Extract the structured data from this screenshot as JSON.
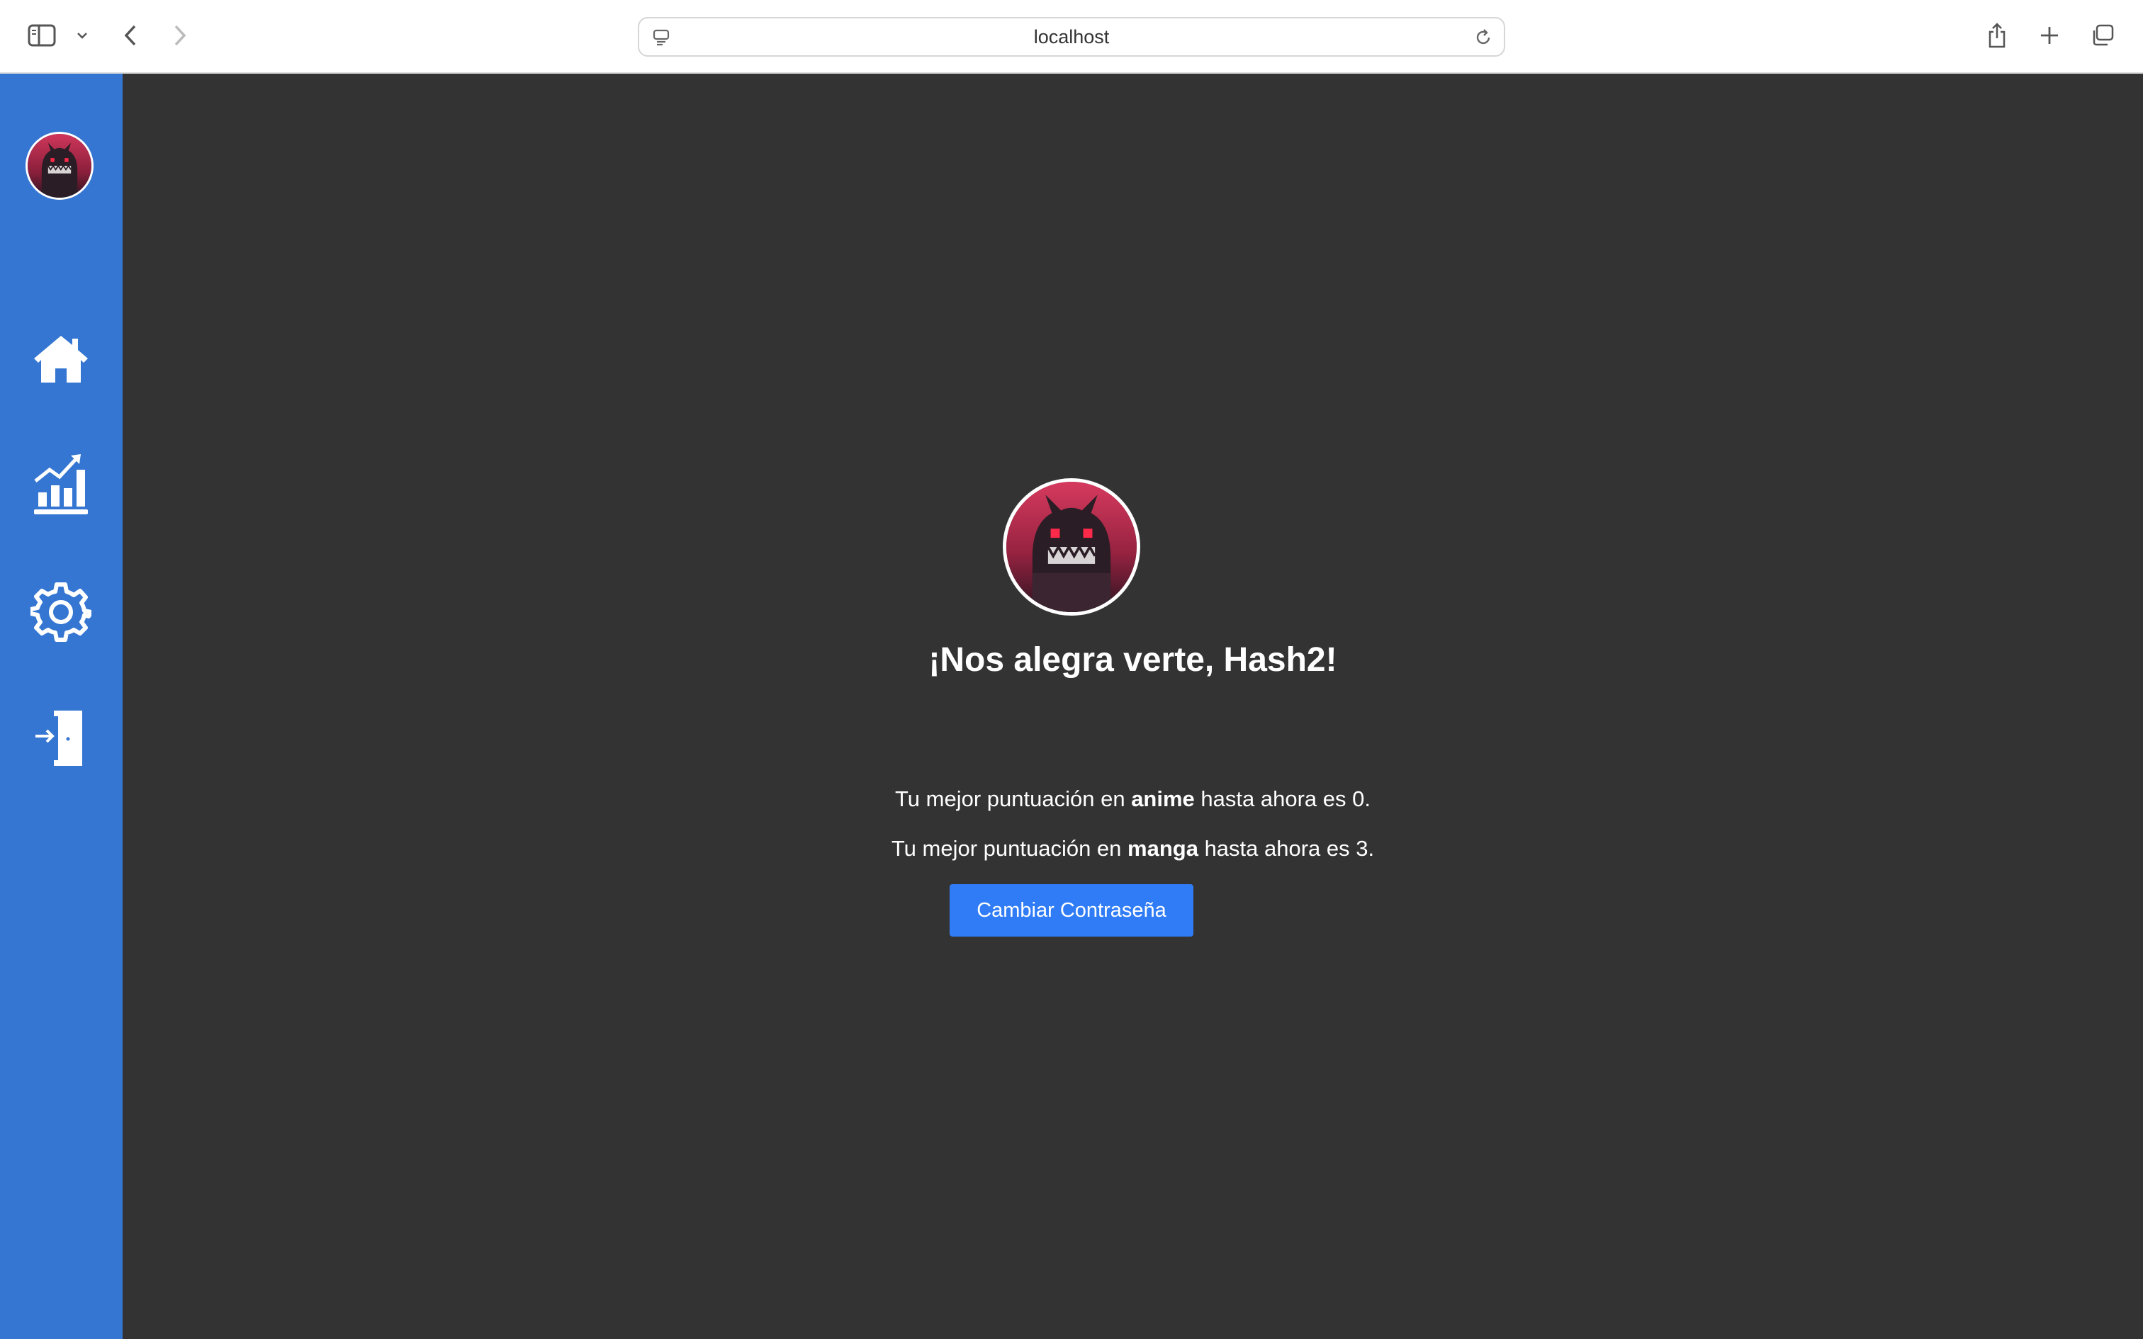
{
  "browser": {
    "url": "localhost",
    "icons": [
      "sidebar-toggle-icon",
      "chevron-down-icon",
      "back-arrow-icon",
      "forward-arrow-icon",
      "site-settings-icon",
      "reload-icon",
      "share-icon",
      "new-tab-plus-icon",
      "tab-overview-icon"
    ]
  },
  "sidebar": {
    "avatar_icon": "demon-avatar",
    "items": [
      {
        "icon": "home-icon"
      },
      {
        "icon": "stats-chart-icon"
      },
      {
        "icon": "settings-gear-icon"
      },
      {
        "icon": "logout-door-icon"
      }
    ],
    "color": "#3476d2"
  },
  "profile": {
    "greeting": "¡Nos alegra verte, Hash2!",
    "anime_line": {
      "prefix": "Tu mejor puntuación en ",
      "keyword": "anime",
      "suffix": " hasta ahora es 0."
    },
    "manga_line": {
      "prefix": "Tu mejor puntuación en ",
      "keyword": "manga",
      "suffix": " hasta ahora es 3."
    },
    "change_password_label": "Cambiar Contraseña"
  },
  "colors": {
    "background": "#333333",
    "accent_button": "#2f7cf6",
    "text": "#ffffff"
  }
}
